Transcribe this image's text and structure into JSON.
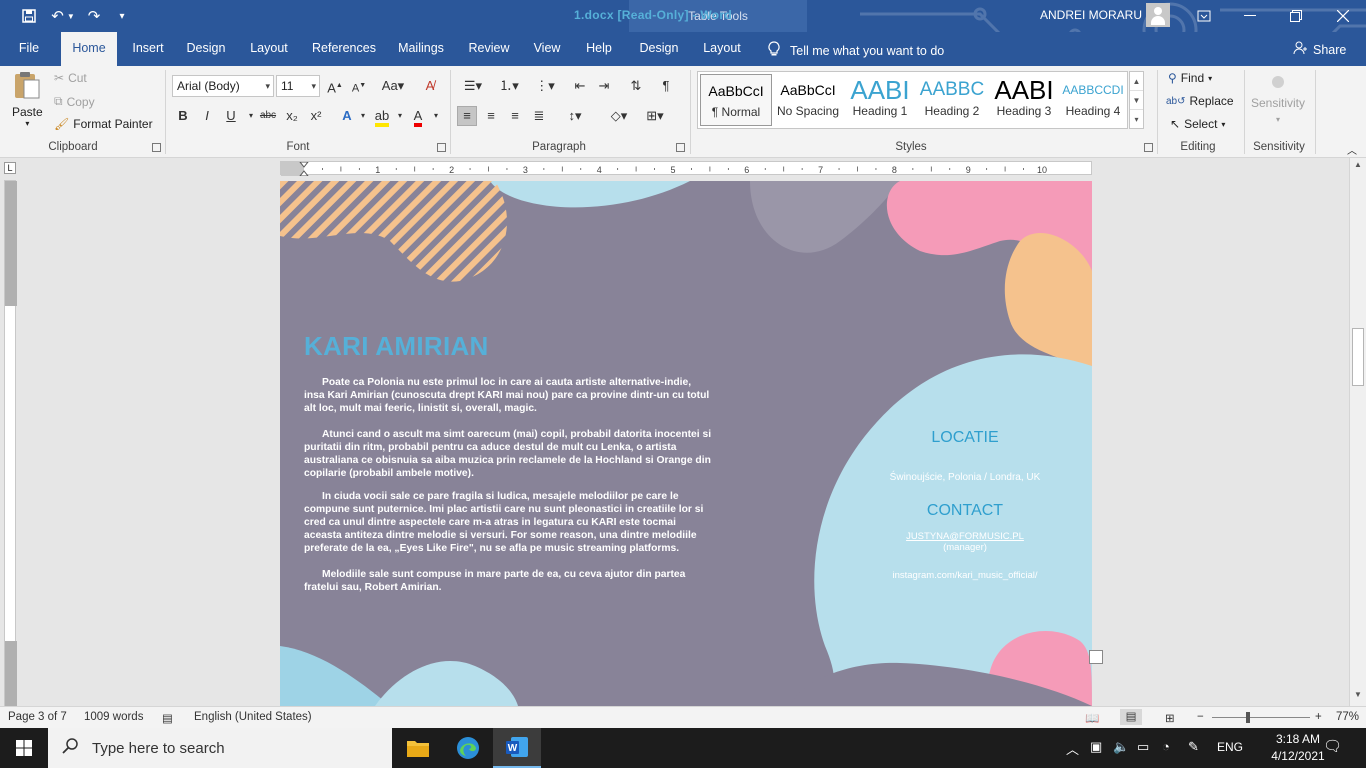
{
  "titlebar": {
    "doc_title": "1.docx [Read-Only]  -  Word",
    "contextual_group": "Table Tools",
    "user_name": "ANDREI MORARU"
  },
  "tabs": [
    "File",
    "Home",
    "Insert",
    "Design",
    "Layout",
    "References",
    "Mailings",
    "Review",
    "View",
    "Help",
    "Design",
    "Layout"
  ],
  "active_tab": "Home",
  "tell_me": "Tell me what you want to do",
  "share": "Share",
  "clipboard": {
    "paste": "Paste",
    "cut": "Cut",
    "copy": "Copy",
    "format_painter": "Format Painter",
    "label": "Clipboard"
  },
  "font": {
    "name": "Arial (Body)",
    "size": "11",
    "label": "Font",
    "bold": "B",
    "italic": "I",
    "underline": "U",
    "strike": "abc",
    "subscript": "x₂",
    "superscript": "x²"
  },
  "paragraph": {
    "label": "Paragraph"
  },
  "styles": {
    "label": "Styles",
    "items": [
      {
        "preview": "AaBbCcI",
        "name": "¶ Normal"
      },
      {
        "preview": "AaBbCcI",
        "name": "No Spacing"
      },
      {
        "preview": "AABI",
        "name": "Heading 1"
      },
      {
        "preview": "AABBC",
        "name": "Heading 2"
      },
      {
        "preview": "AABI",
        "name": "Heading 3"
      },
      {
        "preview": "AABBCCDI",
        "name": "Heading 4"
      }
    ]
  },
  "editing": {
    "label": "Editing",
    "find": "Find",
    "replace": "Replace",
    "select": "Select"
  },
  "sensitivity": {
    "label": "Sensitivity",
    "button": "Sensitivity"
  },
  "ruler_numbers": [
    "1",
    "2",
    "3",
    "4",
    "5",
    "6",
    "7",
    "8",
    "9",
    "10"
  ],
  "document": {
    "title": "KARI AMIRIAN",
    "paragraphs": [
      "Poate ca Polonia nu este primul loc in care ai cauta artiste alternative-indie, insa Kari Amirian (cunoscuta drept KARI mai nou) pare ca provine dintr-un cu totul alt loc, mult mai feeric, linistit si, overall, magic.",
      "Atunci cand o ascult ma simt oarecum (mai) copil, probabil datorita inocentei si puritatii din ritm, probabil pentru ca aduce destul de mult cu Lenka, o artista australiana ce obisnuia sa aiba muzica prin reclamele de la Hochland si Orange din copilarie (probabil ambele motive).",
      "In ciuda vocii sale ce pare fragila si ludica, mesajele melodiilor pe care le compune sunt puternice. Imi plac artistii care nu sunt pleonastici in creatiile lor si cred ca unul dintre aspectele care m-a atras in legatura cu KARI este tocmai aceasta antiteza dintre melodie si versuri. For some reason, una dintre melodiile preferate de la ea, „Eyes Like Fire\", nu se afla pe music streaming platforms.",
      "Melodiile sale sunt compuse in mare parte de ea, cu ceva ajutor din partea fratelui sau, Robert Amirian."
    ],
    "locatie_heading": "LOCATIE",
    "locatie_text": "Świnoujście, Polonia / Londra, UK",
    "contact_heading": "CONTACT",
    "contact_email": "JUSTYNA@FORMUSIC.PL",
    "contact_role": "(manager)",
    "instagram": "instagram.com/kari_music_official/"
  },
  "status": {
    "page": "Page 3 of 7",
    "words": "1009 words",
    "language": "English (United States)",
    "zoom": "77%"
  },
  "taskbar": {
    "search_placeholder": "Type here to search",
    "lang": "ENG",
    "time": "3:18 AM",
    "date": "4/12/2021"
  },
  "colors": {
    "word_blue": "#2b579a",
    "page_bg": "#888398",
    "title_blue": "#56b0d8",
    "light_blue": "#b7dfec",
    "pink": "#f59bb8",
    "peach": "#f5c28d"
  }
}
